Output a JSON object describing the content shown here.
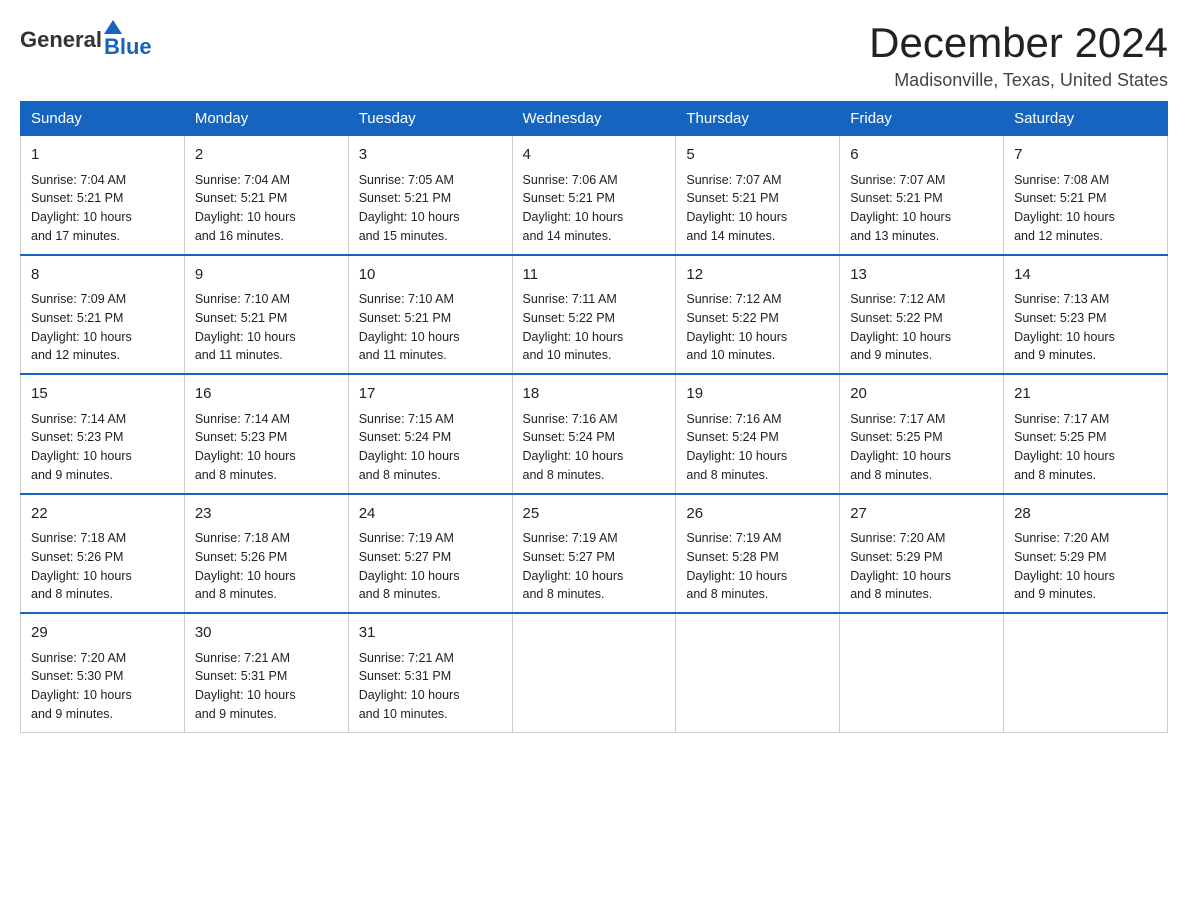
{
  "logo": {
    "general": "General",
    "blue": "Blue"
  },
  "header": {
    "month": "December 2024",
    "location": "Madisonville, Texas, United States"
  },
  "days": [
    "Sunday",
    "Monday",
    "Tuesday",
    "Wednesday",
    "Thursday",
    "Friday",
    "Saturday"
  ],
  "weeks": [
    [
      {
        "num": "1",
        "sunrise": "7:04 AM",
        "sunset": "5:21 PM",
        "daylight": "10 hours and 17 minutes."
      },
      {
        "num": "2",
        "sunrise": "7:04 AM",
        "sunset": "5:21 PM",
        "daylight": "10 hours and 16 minutes."
      },
      {
        "num": "3",
        "sunrise": "7:05 AM",
        "sunset": "5:21 PM",
        "daylight": "10 hours and 15 minutes."
      },
      {
        "num": "4",
        "sunrise": "7:06 AM",
        "sunset": "5:21 PM",
        "daylight": "10 hours and 14 minutes."
      },
      {
        "num": "5",
        "sunrise": "7:07 AM",
        "sunset": "5:21 PM",
        "daylight": "10 hours and 14 minutes."
      },
      {
        "num": "6",
        "sunrise": "7:07 AM",
        "sunset": "5:21 PM",
        "daylight": "10 hours and 13 minutes."
      },
      {
        "num": "7",
        "sunrise": "7:08 AM",
        "sunset": "5:21 PM",
        "daylight": "10 hours and 12 minutes."
      }
    ],
    [
      {
        "num": "8",
        "sunrise": "7:09 AM",
        "sunset": "5:21 PM",
        "daylight": "10 hours and 12 minutes."
      },
      {
        "num": "9",
        "sunrise": "7:10 AM",
        "sunset": "5:21 PM",
        "daylight": "10 hours and 11 minutes."
      },
      {
        "num": "10",
        "sunrise": "7:10 AM",
        "sunset": "5:21 PM",
        "daylight": "10 hours and 11 minutes."
      },
      {
        "num": "11",
        "sunrise": "7:11 AM",
        "sunset": "5:22 PM",
        "daylight": "10 hours and 10 minutes."
      },
      {
        "num": "12",
        "sunrise": "7:12 AM",
        "sunset": "5:22 PM",
        "daylight": "10 hours and 10 minutes."
      },
      {
        "num": "13",
        "sunrise": "7:12 AM",
        "sunset": "5:22 PM",
        "daylight": "10 hours and 9 minutes."
      },
      {
        "num": "14",
        "sunrise": "7:13 AM",
        "sunset": "5:23 PM",
        "daylight": "10 hours and 9 minutes."
      }
    ],
    [
      {
        "num": "15",
        "sunrise": "7:14 AM",
        "sunset": "5:23 PM",
        "daylight": "10 hours and 9 minutes."
      },
      {
        "num": "16",
        "sunrise": "7:14 AM",
        "sunset": "5:23 PM",
        "daylight": "10 hours and 8 minutes."
      },
      {
        "num": "17",
        "sunrise": "7:15 AM",
        "sunset": "5:24 PM",
        "daylight": "10 hours and 8 minutes."
      },
      {
        "num": "18",
        "sunrise": "7:16 AM",
        "sunset": "5:24 PM",
        "daylight": "10 hours and 8 minutes."
      },
      {
        "num": "19",
        "sunrise": "7:16 AM",
        "sunset": "5:24 PM",
        "daylight": "10 hours and 8 minutes."
      },
      {
        "num": "20",
        "sunrise": "7:17 AM",
        "sunset": "5:25 PM",
        "daylight": "10 hours and 8 minutes."
      },
      {
        "num": "21",
        "sunrise": "7:17 AM",
        "sunset": "5:25 PM",
        "daylight": "10 hours and 8 minutes."
      }
    ],
    [
      {
        "num": "22",
        "sunrise": "7:18 AM",
        "sunset": "5:26 PM",
        "daylight": "10 hours and 8 minutes."
      },
      {
        "num": "23",
        "sunrise": "7:18 AM",
        "sunset": "5:26 PM",
        "daylight": "10 hours and 8 minutes."
      },
      {
        "num": "24",
        "sunrise": "7:19 AM",
        "sunset": "5:27 PM",
        "daylight": "10 hours and 8 minutes."
      },
      {
        "num": "25",
        "sunrise": "7:19 AM",
        "sunset": "5:27 PM",
        "daylight": "10 hours and 8 minutes."
      },
      {
        "num": "26",
        "sunrise": "7:19 AM",
        "sunset": "5:28 PM",
        "daylight": "10 hours and 8 minutes."
      },
      {
        "num": "27",
        "sunrise": "7:20 AM",
        "sunset": "5:29 PM",
        "daylight": "10 hours and 8 minutes."
      },
      {
        "num": "28",
        "sunrise": "7:20 AM",
        "sunset": "5:29 PM",
        "daylight": "10 hours and 9 minutes."
      }
    ],
    [
      {
        "num": "29",
        "sunrise": "7:20 AM",
        "sunset": "5:30 PM",
        "daylight": "10 hours and 9 minutes."
      },
      {
        "num": "30",
        "sunrise": "7:21 AM",
        "sunset": "5:31 PM",
        "daylight": "10 hours and 9 minutes."
      },
      {
        "num": "31",
        "sunrise": "7:21 AM",
        "sunset": "5:31 PM",
        "daylight": "10 hours and 10 minutes."
      },
      null,
      null,
      null,
      null
    ]
  ],
  "labels": {
    "sunrise": "Sunrise:",
    "sunset": "Sunset:",
    "daylight": "Daylight:"
  }
}
